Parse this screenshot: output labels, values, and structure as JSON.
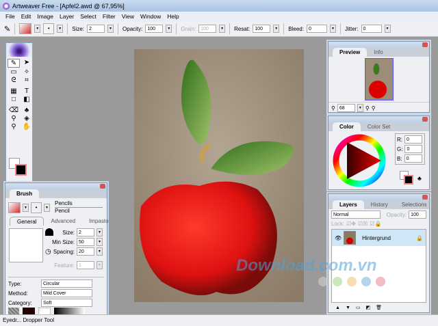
{
  "window": {
    "title": "Artweaver Free - [Apfel2.awd @ 67,95%]"
  },
  "menu": [
    "File",
    "Edit",
    "Image",
    "Layer",
    "Select",
    "Filter",
    "View",
    "Window",
    "Help"
  ],
  "toolbar": {
    "size_label": "Size:",
    "size": "2",
    "opacity_label": "Opacity:",
    "opacity": "100",
    "grain_label": "Grain:",
    "grain": "100",
    "resat_label": "Resat:",
    "resat": "100",
    "bleed_label": "Bleed:",
    "bleed": "0",
    "jitter_label": "Jitter:",
    "jitter": "0"
  },
  "brush": {
    "tab": "Brush",
    "category": "Pencils",
    "variant": "Pencil",
    "tabs": [
      "General",
      "Advanced",
      "Impasto"
    ],
    "size_label": "Size:",
    "size": "2",
    "min_size_label": "Min Size:",
    "min_size": "50",
    "spacing_label": "Spacing:",
    "spacing": "20",
    "feature_label": "Feature:",
    "feature": "1",
    "type_label": "Type:",
    "type": "Circular",
    "method_label": "Method:",
    "method": "Mild Cover",
    "category_label": "Category:",
    "category_value": "Soft"
  },
  "preview": {
    "tabs": [
      "Preview",
      "Info"
    ],
    "zoom": "68"
  },
  "color": {
    "tabs": [
      "Color",
      "Color Set"
    ],
    "r_label": "R:",
    "r": "0",
    "g_label": "G:",
    "g": "0",
    "b_label": "B:",
    "b": "0"
  },
  "layers": {
    "tabs": [
      "Layers",
      "History",
      "Selections"
    ],
    "blend": "Normal",
    "opacity_label": "Opacity:",
    "opacity": "100",
    "lock_label": "Lock:",
    "items": [
      {
        "name": "Hintergrund"
      }
    ]
  },
  "status": {
    "text": "Eyedr... Dropper Tool"
  },
  "watermark": {
    "text": "Download.com.vn",
    "dot_colors": [
      "#d0d0d0",
      "#a8d890",
      "#f5c67a",
      "#7fb8e0",
      "#f08c9a"
    ]
  }
}
